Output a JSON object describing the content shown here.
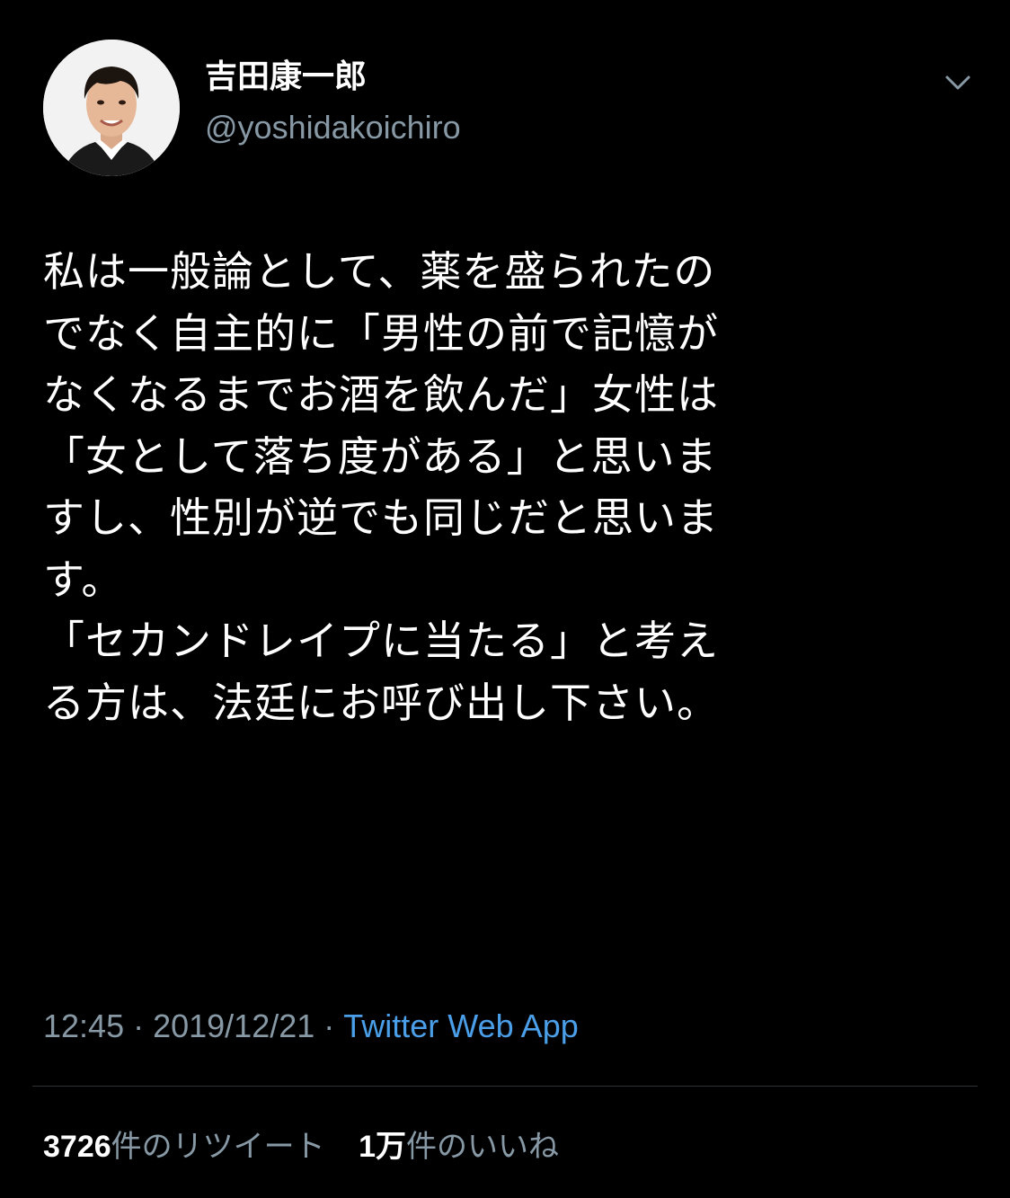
{
  "author": {
    "display_name": "吉田康一郎",
    "handle": "@yoshidakoichiro"
  },
  "tweet": {
    "lines": [
      "私は一般論として、薬を盛られたの",
      "でなく自主的に「男性の前で記憶が",
      "なくなるまでお酒を飲んだ」女性は",
      "「女として落ち度がある」と思いま",
      "すし、性別が逆でも同じだと思いま",
      "す。",
      "「セカンドレイプに当たる」と考え",
      "る方は、法廷にお呼び出し下さい。"
    ],
    "time": "12:45",
    "separator": "·",
    "date": "2019/12/21",
    "source": "Twitter Web App"
  },
  "stats": {
    "retweets": {
      "count": "3726",
      "label": "件のリツイート"
    },
    "likes": {
      "count": "1万",
      "label": "件のいいね"
    }
  },
  "icons": {
    "more": "chevron-down-icon",
    "avatar": "profile-photo"
  },
  "colors": {
    "background": "#000000",
    "text": "#ffffff",
    "secondary": "#8899a6",
    "link": "#4a9fe8",
    "divider": "#2f3336"
  }
}
